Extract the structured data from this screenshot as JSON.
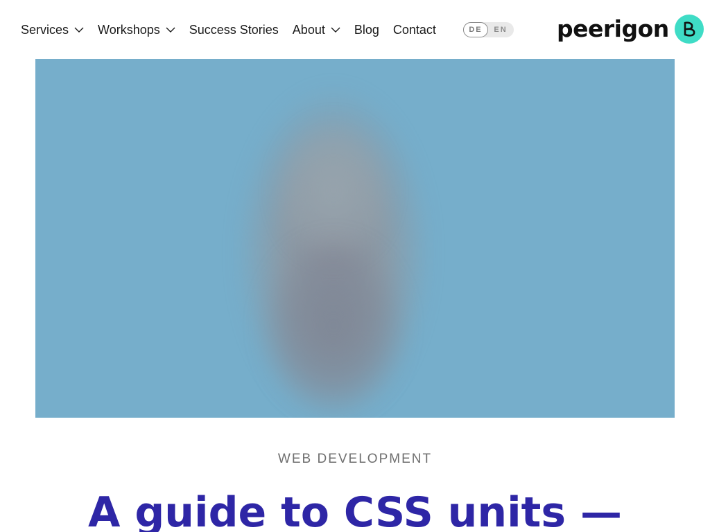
{
  "nav": {
    "items": [
      {
        "label": "Services",
        "has_dropdown": true,
        "icon": "chevron-down-icon"
      },
      {
        "label": "Workshops",
        "has_dropdown": true,
        "icon": "chevron-down-icon"
      },
      {
        "label": "Success Stories",
        "has_dropdown": false
      },
      {
        "label": "About",
        "has_dropdown": true,
        "icon": "chevron-down-icon"
      },
      {
        "label": "Blog",
        "has_dropdown": false
      },
      {
        "label": "Contact",
        "has_dropdown": false
      }
    ]
  },
  "language": {
    "options": [
      "DE",
      "EN"
    ],
    "selected": "DE"
  },
  "brand": {
    "name": "peerigon",
    "logo_icon": "peerigon-logo-icon",
    "logo_color": "#3fdcc6"
  },
  "hero": {
    "image_icon": "blurred-hero-image",
    "background_color": "#76aecb"
  },
  "article": {
    "category": "WEB DEVELOPMENT",
    "title": "A guide to CSS units —",
    "title_color": "#2e26a6"
  }
}
